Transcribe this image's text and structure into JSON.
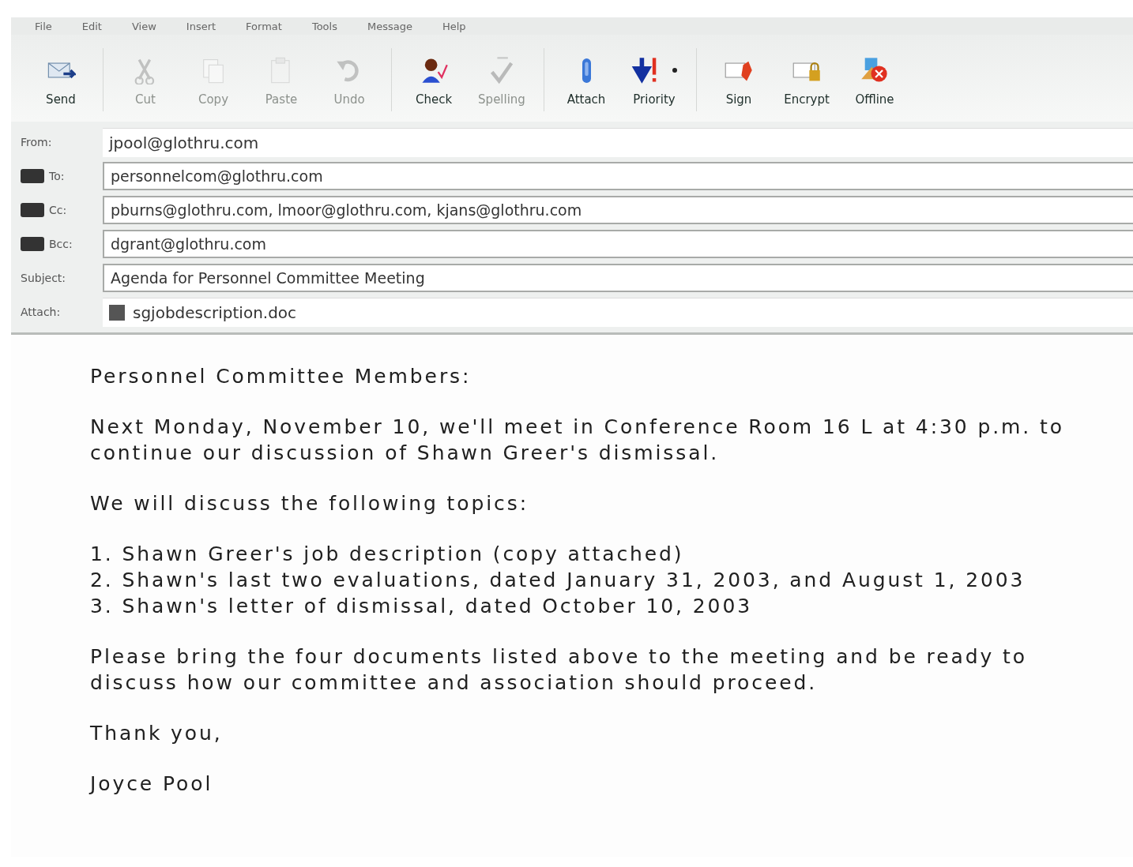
{
  "menu": [
    "File",
    "Edit",
    "View",
    "Insert",
    "Format",
    "Tools",
    "Message",
    "Help"
  ],
  "toolbar_groups": [
    [
      {
        "label": "Send",
        "disabled": false
      }
    ],
    [
      {
        "label": "Cut",
        "disabled": true
      },
      {
        "label": "Copy",
        "disabled": true
      },
      {
        "label": "Paste",
        "disabled": true
      },
      {
        "label": "Undo",
        "disabled": true
      }
    ],
    [
      {
        "label": "Check",
        "disabled": false
      },
      {
        "label": "Spelling",
        "disabled": true
      }
    ],
    [
      {
        "label": "Attach",
        "disabled": false
      },
      {
        "label": "Priority",
        "disabled": false,
        "dropdown": true
      }
    ],
    [
      {
        "label": "Sign",
        "disabled": false
      },
      {
        "label": "Encrypt",
        "disabled": false
      },
      {
        "label": "Offline",
        "disabled": false
      }
    ]
  ],
  "header_fields": [
    {
      "kind": "plain",
      "label": "From:",
      "value": "jpool@glothru.com"
    },
    {
      "kind": "address",
      "label": "To:",
      "value": "personnelcom@glothru.com"
    },
    {
      "kind": "address",
      "label": "Cc:",
      "value": "pburns@glothru.com, lmoor@glothru.com, kjans@glothru.com"
    },
    {
      "kind": "address",
      "label": "Bcc:",
      "value": "dgrant@glothru.com"
    },
    {
      "kind": "text",
      "label": "Subject:",
      "value": "Agenda for Personnel Committee Meeting"
    },
    {
      "kind": "attachment",
      "label": "Attach:",
      "value": "sgjobdescription.doc"
    }
  ],
  "body": [
    {
      "kind": "paragraph",
      "text": "Personnel Committee Members:"
    },
    {
      "kind": "paragraph",
      "text": "Next Monday, November 10, we'll meet in Conference Room 16 L at 4:30 p.m. to continue our discussion of Shawn Greer's dismissal."
    },
    {
      "kind": "paragraph",
      "text": "We will discuss the following topics:"
    },
    {
      "kind": "list",
      "items": [
        "1. Shawn Greer's job description (copy attached)",
        "2. Shawn's last two evaluations, dated January 31, 2003, and August 1, 2003",
        "3. Shawn's letter of dismissal, dated October 10, 2003"
      ]
    },
    {
      "kind": "paragraph",
      "text": "Please bring the four documents listed above to the meeting and be ready to discuss how our committee and association should proceed."
    },
    {
      "kind": "paragraph",
      "text": "Thank you,"
    },
    {
      "kind": "paragraph",
      "text": "Joyce Pool"
    }
  ]
}
